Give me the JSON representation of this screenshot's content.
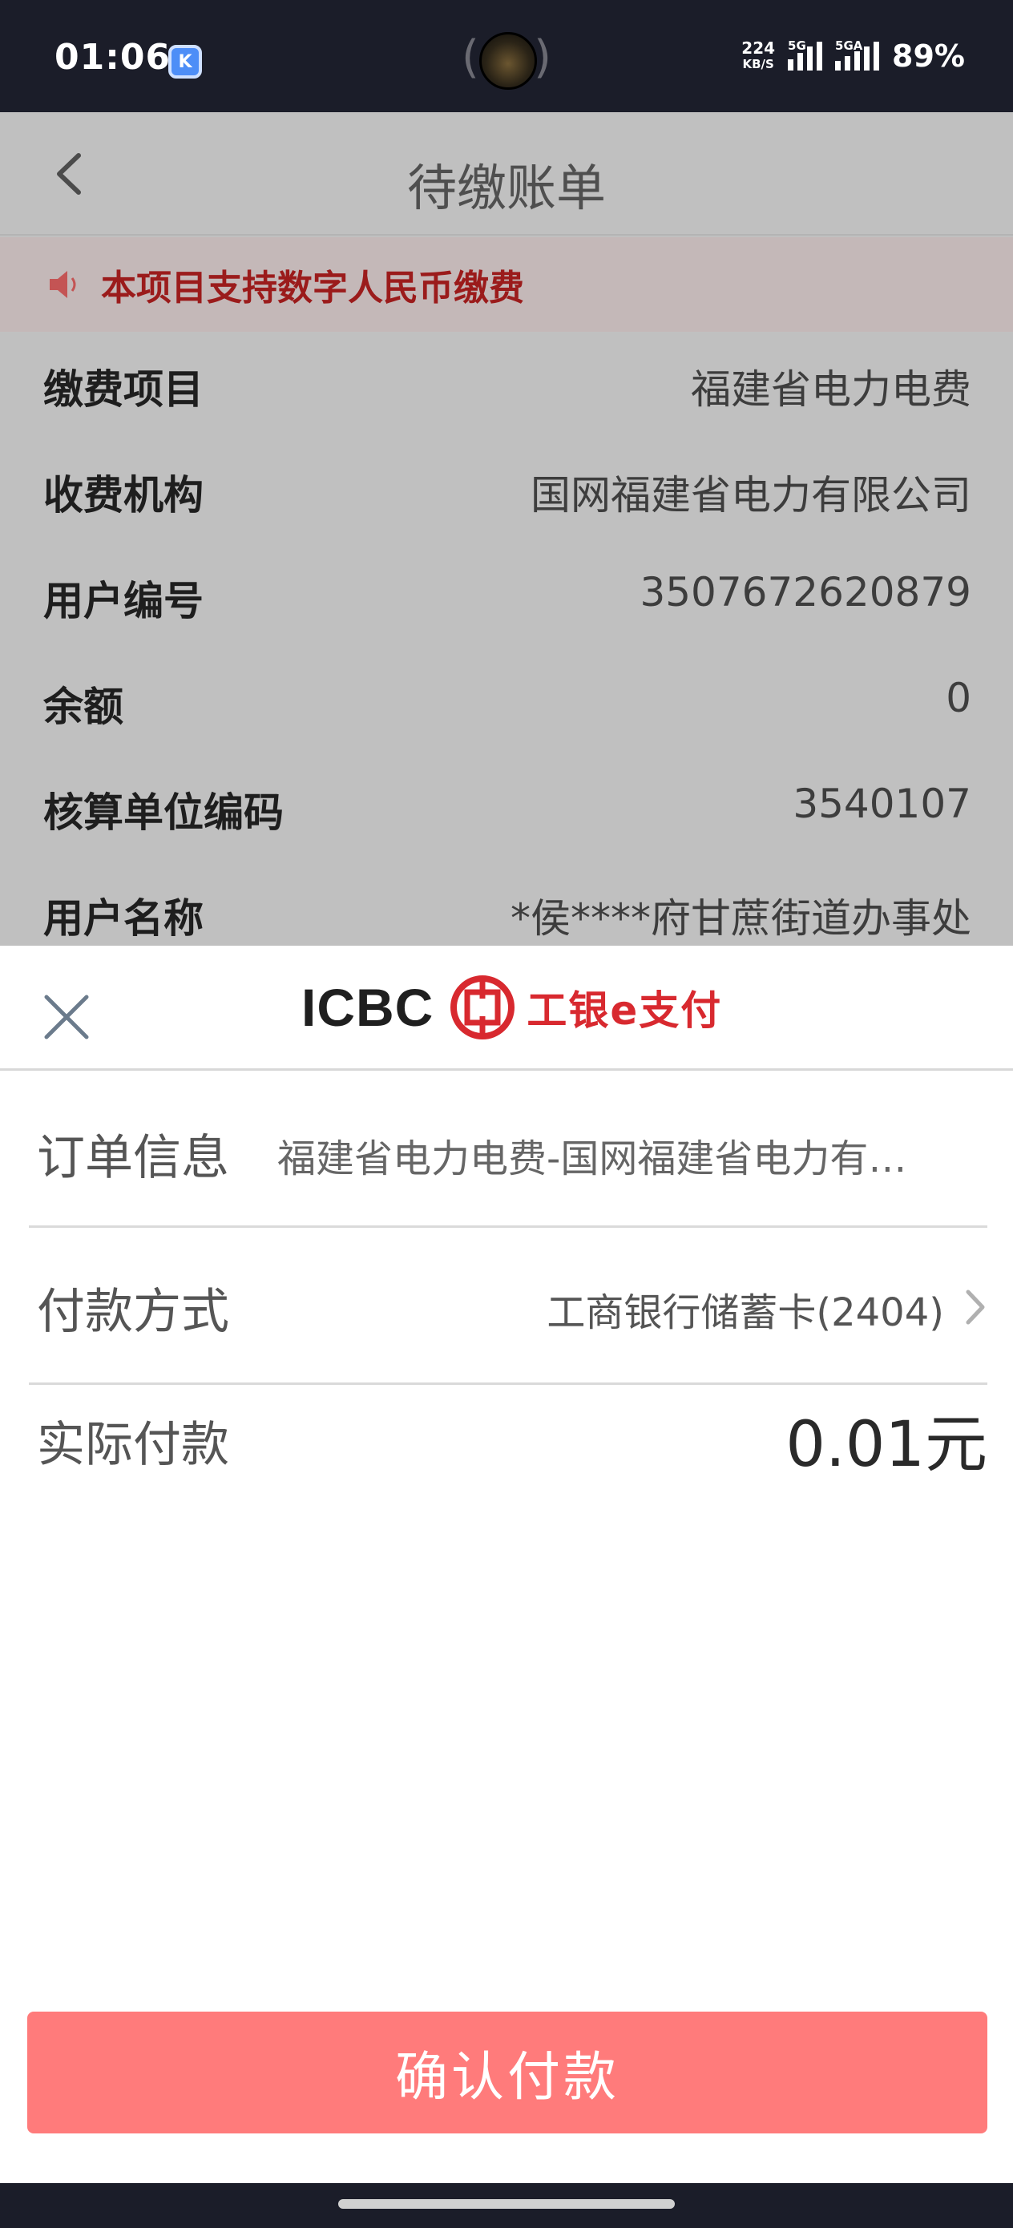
{
  "status_bar": {
    "time": "01:06",
    "app_icon_letter": "K",
    "net_speed_value": "224",
    "net_speed_unit": "KB/S",
    "signal1_label": "5G",
    "signal2_label": "5GA",
    "battery": "89%"
  },
  "background_page": {
    "title": "待缴账单",
    "notice": "本项目支持数字人民币缴费",
    "rows": [
      {
        "label": "缴费项目",
        "value": "福建省电力电费"
      },
      {
        "label": "收费机构",
        "value": "国网福建省电力有限公司"
      },
      {
        "label": "用户编号",
        "value": "3507672620879"
      },
      {
        "label": "余额",
        "value": "0"
      },
      {
        "label": "核算单位编码",
        "value": "3540107"
      },
      {
        "label": "用户名称",
        "value": "*侯****府甘蔗街道办事处"
      }
    ]
  },
  "pay_sheet": {
    "brand_name": "ICBC",
    "brand_product": "工银e支付",
    "order_label": "订单信息",
    "order_value": "福建省电力电费-国网福建省电力有限公司",
    "method_label": "付款方式",
    "method_value": "工商银行储蓄卡(2404)",
    "amount_label": "实际付款",
    "amount_value": "0.01元",
    "confirm_label": "确认付款"
  },
  "colors": {
    "brand_red": "#d8292f",
    "confirm_button": "#ff7b7b",
    "notice_text": "#9b1b1b"
  },
  "icons": [
    "back-arrow-icon",
    "speaker-icon",
    "close-icon",
    "icbc-logo-icon",
    "chevron-right-icon"
  ]
}
